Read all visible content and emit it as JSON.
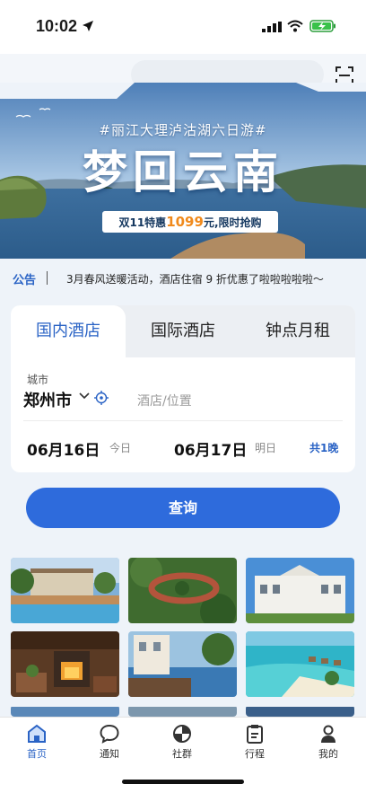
{
  "status_bar": {
    "time": "10:02"
  },
  "banner": {
    "tagline": "#丽江大理泸沽湖六日游#",
    "title": "梦回云南",
    "promo_prefix": "双11特惠",
    "promo_price": "1099",
    "promo_suffix": "元,限时抢购"
  },
  "notice": {
    "label": "公告",
    "text": "3月春风送暖活动，酒店住宿 9 折优惠了啦啦啦啦啦～"
  },
  "booking": {
    "tabs": [
      "国内酒店",
      "国际酒店",
      "钟点月租"
    ],
    "active_tab": 0,
    "city_label": "城市",
    "city": "郑州市",
    "place_placeholder": "酒店/位置",
    "checkin_date": "06月16日",
    "checkin_day": "今日",
    "checkout_date": "06月17日",
    "checkout_day": "明日",
    "nights": "共1晚"
  },
  "query_button": "查询",
  "nav": {
    "items": [
      {
        "label": "首页",
        "icon": "home-icon",
        "active": true
      },
      {
        "label": "通知",
        "icon": "message-icon",
        "active": false
      },
      {
        "label": "社群",
        "icon": "community-icon",
        "active": false
      },
      {
        "label": "行程",
        "icon": "clipboard-icon",
        "active": false
      },
      {
        "label": "我的",
        "icon": "user-icon",
        "active": false
      }
    ]
  },
  "colors": {
    "accent": "#2e6bdc",
    "promo_highlight": "#f08a1c"
  }
}
